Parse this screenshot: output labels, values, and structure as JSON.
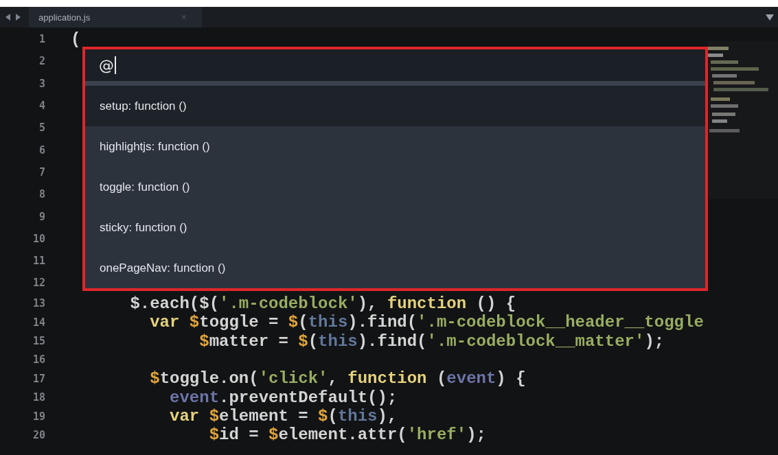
{
  "tabs": [
    {
      "label": "application.js",
      "close": "×",
      "selected": true
    }
  ],
  "lines": [
    {
      "number": "1",
      "tokens": [
        {
          "kind": "plain",
          "text": "("
        }
      ]
    },
    {
      "number": "2"
    },
    {
      "number": "3"
    },
    {
      "number": "4"
    },
    {
      "number": "5"
    },
    {
      "number": "6"
    },
    {
      "number": "7"
    },
    {
      "number": "8"
    },
    {
      "number": "9"
    },
    {
      "number": "10"
    },
    {
      "number": "11"
    },
    {
      "number": "12"
    },
    {
      "number": "13",
      "tokens": [
        {
          "kind": "plain",
          "text": "      $.each($("
        },
        {
          "kind": "string",
          "text": "'.m-codeblock'"
        },
        {
          "kind": "plain",
          "text": "), "
        },
        {
          "kind": "keyword",
          "text": "function"
        },
        {
          "kind": "plain",
          "text": " () {"
        }
      ]
    },
    {
      "number": "14",
      "tokens": [
        {
          "kind": "keyword",
          "text": "        var "
        },
        {
          "kind": "dollar",
          "text": "$"
        },
        {
          "kind": "plain",
          "text": "toggle = "
        },
        {
          "kind": "dollar",
          "text": "$"
        },
        {
          "kind": "plain",
          "text": "("
        },
        {
          "kind": "this",
          "text": "this"
        },
        {
          "kind": "plain",
          "text": ").find("
        },
        {
          "kind": "string",
          "text": "'.m-codeblock__header__toggle"
        }
      ]
    },
    {
      "number": "15",
      "tokens": [
        {
          "kind": "dollar",
          "text": "             $"
        },
        {
          "kind": "plain",
          "text": "matter = "
        },
        {
          "kind": "dollar",
          "text": "$"
        },
        {
          "kind": "plain",
          "text": "("
        },
        {
          "kind": "this",
          "text": "this"
        },
        {
          "kind": "plain",
          "text": ").find("
        },
        {
          "kind": "string",
          "text": "'.m-codeblock__matter'"
        },
        {
          "kind": "plain",
          "text": ");"
        }
      ]
    },
    {
      "number": "16"
    },
    {
      "number": "17",
      "tokens": [
        {
          "kind": "dollar",
          "text": "        $"
        },
        {
          "kind": "plain",
          "text": "toggle.on("
        },
        {
          "kind": "string",
          "text": "'click'"
        },
        {
          "kind": "plain",
          "text": ", "
        },
        {
          "kind": "keyword",
          "text": "function"
        },
        {
          "kind": "plain",
          "text": " ("
        },
        {
          "kind": "param",
          "text": "event"
        },
        {
          "kind": "plain",
          "text": ") {"
        }
      ]
    },
    {
      "number": "18",
      "tokens": [
        {
          "kind": "param",
          "text": "          event"
        },
        {
          "kind": "plain",
          "text": ".preventDefault();"
        }
      ]
    },
    {
      "number": "19",
      "tokens": [
        {
          "kind": "keyword",
          "text": "          var "
        },
        {
          "kind": "dollar",
          "text": "$"
        },
        {
          "kind": "plain",
          "text": "element = "
        },
        {
          "kind": "dollar",
          "text": "$"
        },
        {
          "kind": "plain",
          "text": "("
        },
        {
          "kind": "this",
          "text": "this"
        },
        {
          "kind": "plain",
          "text": "),"
        }
      ]
    },
    {
      "number": "20",
      "tokens": [
        {
          "kind": "dollar",
          "text": "              $"
        },
        {
          "kind": "plain",
          "text": "id = "
        },
        {
          "kind": "dollar",
          "text": "$"
        },
        {
          "kind": "plain",
          "text": "element.attr("
        },
        {
          "kind": "string",
          "text": "'href'"
        },
        {
          "kind": "plain",
          "text": ");"
        }
      ]
    }
  ],
  "goto_symbol": {
    "query": "@",
    "items": [
      {
        "label": "setup: function ()",
        "selected": true
      },
      {
        "label": "highlightjs: function ()",
        "selected": false
      },
      {
        "label": "toggle: function ()",
        "selected": false
      },
      {
        "label": "sticky: function ()",
        "selected": false
      },
      {
        "label": "onePageNav: function ()",
        "selected": false
      }
    ]
  }
}
